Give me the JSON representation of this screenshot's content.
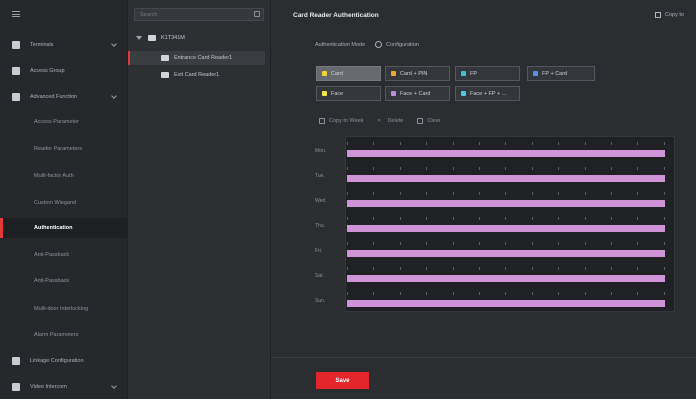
{
  "nav": {
    "items": [
      {
        "label": "Terminals",
        "kind": "top"
      },
      {
        "label": "Access Group",
        "kind": "top"
      },
      {
        "label": "Advanced Function",
        "kind": "top"
      },
      {
        "label": "Access Parameter",
        "kind": "sub"
      },
      {
        "label": "Reader Parameters",
        "kind": "sub"
      },
      {
        "label": "Multi-factor Auth",
        "kind": "sub"
      },
      {
        "label": "Custom Wiegand",
        "kind": "sub"
      },
      {
        "label": "Authentication",
        "kind": "sub",
        "active": true
      },
      {
        "label": "Anti-Passback",
        "kind": "sub"
      },
      {
        "label": "Anti-Passback",
        "kind": "sub"
      },
      {
        "label": "Multi-door Interlocking",
        "kind": "sub"
      },
      {
        "label": "Alarm Parameters",
        "kind": "sub"
      },
      {
        "label": "Linkage Configuration",
        "kind": "top"
      },
      {
        "label": "Video Intercom",
        "kind": "top"
      }
    ]
  },
  "tree": {
    "search_placeholder": "Search",
    "root_label": "K1T341M",
    "children": [
      "Entrance Card Reader1",
      "Exit Card Reader1"
    ]
  },
  "main": {
    "title": "Card Reader Authentication",
    "copy_to": "Copy to",
    "mode_label": "Authentication Mode",
    "config_label": "Configuration",
    "modes": [
      {
        "label": "Card",
        "color": "#f1d23a",
        "selected": true
      },
      {
        "label": "Card + PIN",
        "color": "#f0a533"
      },
      {
        "label": "FP",
        "color": "#3fc2d8"
      },
      {
        "label": "FP + Card",
        "color": "#5a8fe6"
      },
      {
        "label": "Face",
        "color": "#f3e24a"
      },
      {
        "label": "Face + Card",
        "color": "#c08be0"
      },
      {
        "label": "Face + FP + ...",
        "color": "#4fc7e4"
      }
    ],
    "tools": [
      "Copy to Week",
      "Delete",
      "Clear"
    ],
    "days": [
      "Mon.",
      "Tue.",
      "Wed.",
      "Thu.",
      "Fri.",
      "Sat.",
      "Sun."
    ],
    "bar_color": "#cf94d8",
    "save": "Save"
  }
}
